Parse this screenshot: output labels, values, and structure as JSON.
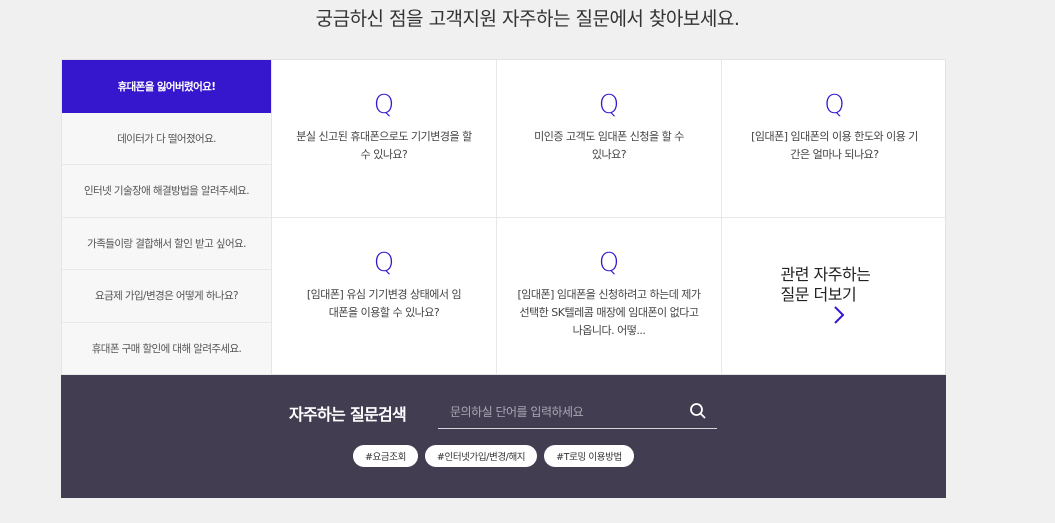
{
  "headline": "궁금하신 점을 고객지원 자주하는 질문에서 찾아보세요.",
  "sidebar": {
    "items": [
      {
        "label": "휴대폰을 잃어버렸어요!"
      },
      {
        "label": "데이터가 다 떨어졌어요."
      },
      {
        "label": "인터넷 기술장애 해결방법을 알려주세요."
      },
      {
        "label": "가족들이랑 결합해서 할인 받고 싶어요."
      },
      {
        "label": "요금제 가입/변경은 어떻게 하나요?"
      },
      {
        "label": "휴대폰 구매 할인에 대해 알려주세요."
      }
    ],
    "active_index": 0
  },
  "faq": {
    "q_mark": "Q",
    "cards": [
      {
        "text": "분실 신고된 휴대폰으로도 기기변경을 할 수 있나요?"
      },
      {
        "text": "미인증 고객도 임대폰 신청을 할 수 있나요?"
      },
      {
        "text": "[임대폰] 임대폰의 이용 한도와 이용 기간은 얼마나 되나요?"
      },
      {
        "text": "[임대폰] 유심 기기변경 상태에서 임대폰을 이용할 수 있나요?"
      },
      {
        "text": "[임대폰] 임대폰을 신청하려고 하는데 제가 선택한 SK텔레콤 매장에 임대폰이 없다고 나옵니다. 어떻..."
      }
    ],
    "more_label": "관련 자주하는 질문 더보기"
  },
  "search": {
    "title": "자주하는 질문검색",
    "placeholder": "문의하실 단어를 입력하세요",
    "tags": [
      "#요금조회",
      "#인터넷가입/변경/해지",
      "#T로밍 이용방법"
    ]
  },
  "colors": {
    "accent": "#3617ce",
    "search_bg": "#433d52",
    "page_bg": "#f0f0f0"
  },
  "icons": {
    "search": "search-icon",
    "more": "chevron-right-icon"
  }
}
